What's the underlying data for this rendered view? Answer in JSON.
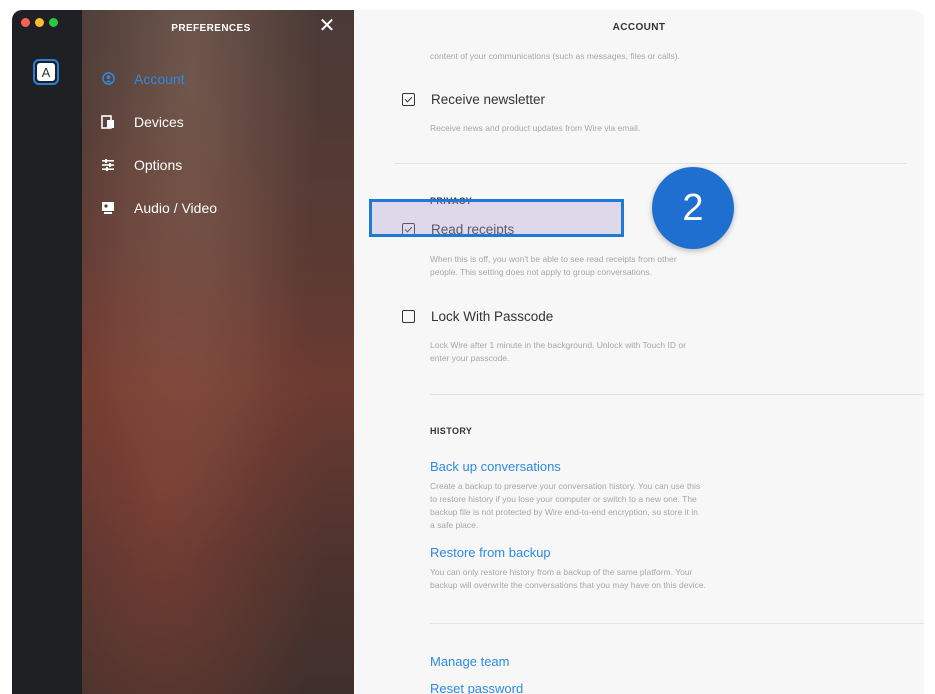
{
  "window": {
    "traffic_lights": [
      "close",
      "minimize",
      "zoom"
    ]
  },
  "rail": {
    "avatar_letter": "A"
  },
  "sidebar": {
    "title": "PREFERENCES",
    "close_glyph": "✕",
    "items": [
      {
        "label": "Account",
        "icon": "account-icon",
        "active": true
      },
      {
        "label": "Devices",
        "icon": "devices-icon",
        "active": false
      },
      {
        "label": "Options",
        "icon": "options-icon",
        "active": false
      },
      {
        "label": "Audio / Video",
        "icon": "audio-video-icon",
        "active": false
      }
    ]
  },
  "main": {
    "header": "ACCOUNT",
    "top_cut_text": "content of your communications (such as messages, files or calls).",
    "newsletter": {
      "label": "Receive newsletter",
      "checked": true,
      "description": "Receive news and product updates from Wire via email."
    },
    "privacy": {
      "title": "PRIVACY",
      "read_receipts": {
        "label": "Read receipts",
        "checked": true,
        "description_1": "When this is off, you won't be able to see read receipts from other",
        "description_2": "people. This setting does not apply to group conversations."
      },
      "lock": {
        "label": "Lock With Passcode",
        "checked": false,
        "description_1": "Lock Wire after 1 minute in the background. Unlock with Touch ID or",
        "description_2": "enter your passcode."
      }
    },
    "history": {
      "title": "HISTORY",
      "backup_link": "Back up conversations",
      "backup_desc_1": "Create a backup to preserve your conversation history. You can use this",
      "backup_desc_2": "to restore history if you lose your computer or switch to a new one. The",
      "backup_desc_3": "backup file is not protected by Wire end-to-end encryption, so store it in",
      "backup_desc_4": "a safe place.",
      "restore_link": "Restore from backup",
      "restore_desc_1": "You can only restore history from a backup of the same platform. Your",
      "restore_desc_2": "backup will overwrite the conversations that you may have on this device."
    },
    "manage_team": "Manage team",
    "reset_password": "Reset password"
  },
  "annotation": {
    "step_number": "2",
    "highlight_color": "#1f7ad6",
    "badge_color": "#1f6fd0"
  },
  "colors": {
    "accent": "#2c8be3",
    "rail": "#1e2023"
  }
}
